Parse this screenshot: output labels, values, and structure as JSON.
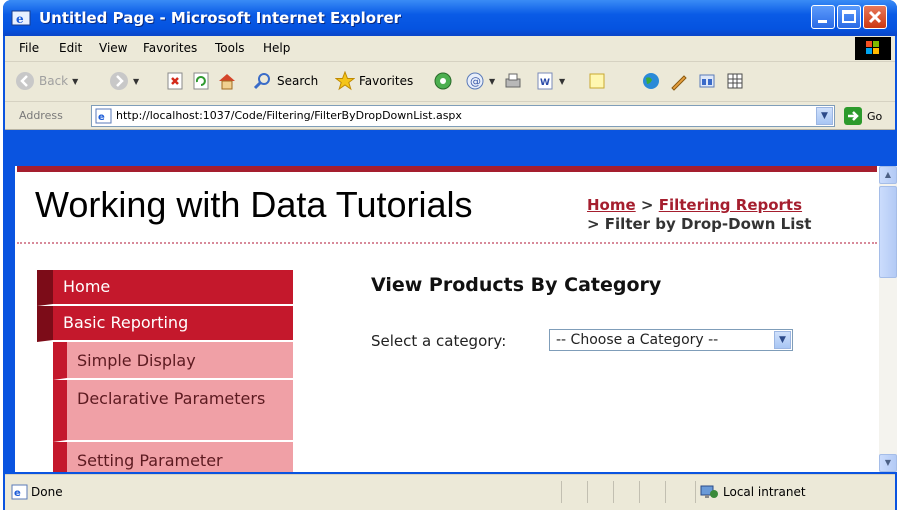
{
  "window": {
    "title": "Untitled Page - Microsoft Internet Explorer"
  },
  "menubar": {
    "items": [
      "File",
      "Edit",
      "View",
      "Favorites",
      "Tools",
      "Help"
    ]
  },
  "toolbar": {
    "back_label": "Back",
    "search_label": "Search",
    "favorites_label": "Favorites"
  },
  "addressbar": {
    "label": "Address",
    "url": "http://localhost:1037/Code/Filtering/FilterByDropDownList.aspx",
    "go_label": "Go"
  },
  "page": {
    "site_title": "Working with Data Tutorials",
    "breadcrumb": {
      "home": "Home",
      "sep1": ">",
      "section": "Filtering Reports",
      "current": "> Filter by Drop-Down List"
    },
    "menu": {
      "home": "Home",
      "basic_reporting": "Basic Reporting",
      "simple_display": "Simple Display",
      "declarative_parameters": "Declarative Parameters",
      "setting_parameter": "Setting Parameter"
    },
    "heading": "View Products By Category",
    "select_label": "Select a category:",
    "select_value": "-- Choose a Category --"
  },
  "statusbar": {
    "text": "Done",
    "zone": "Local intranet"
  },
  "colors": {
    "brand": "#a51e2e",
    "menu_top": "#c4182c",
    "menu_sub": "#f0a0a6",
    "xp_blue": "#0a54e0"
  }
}
